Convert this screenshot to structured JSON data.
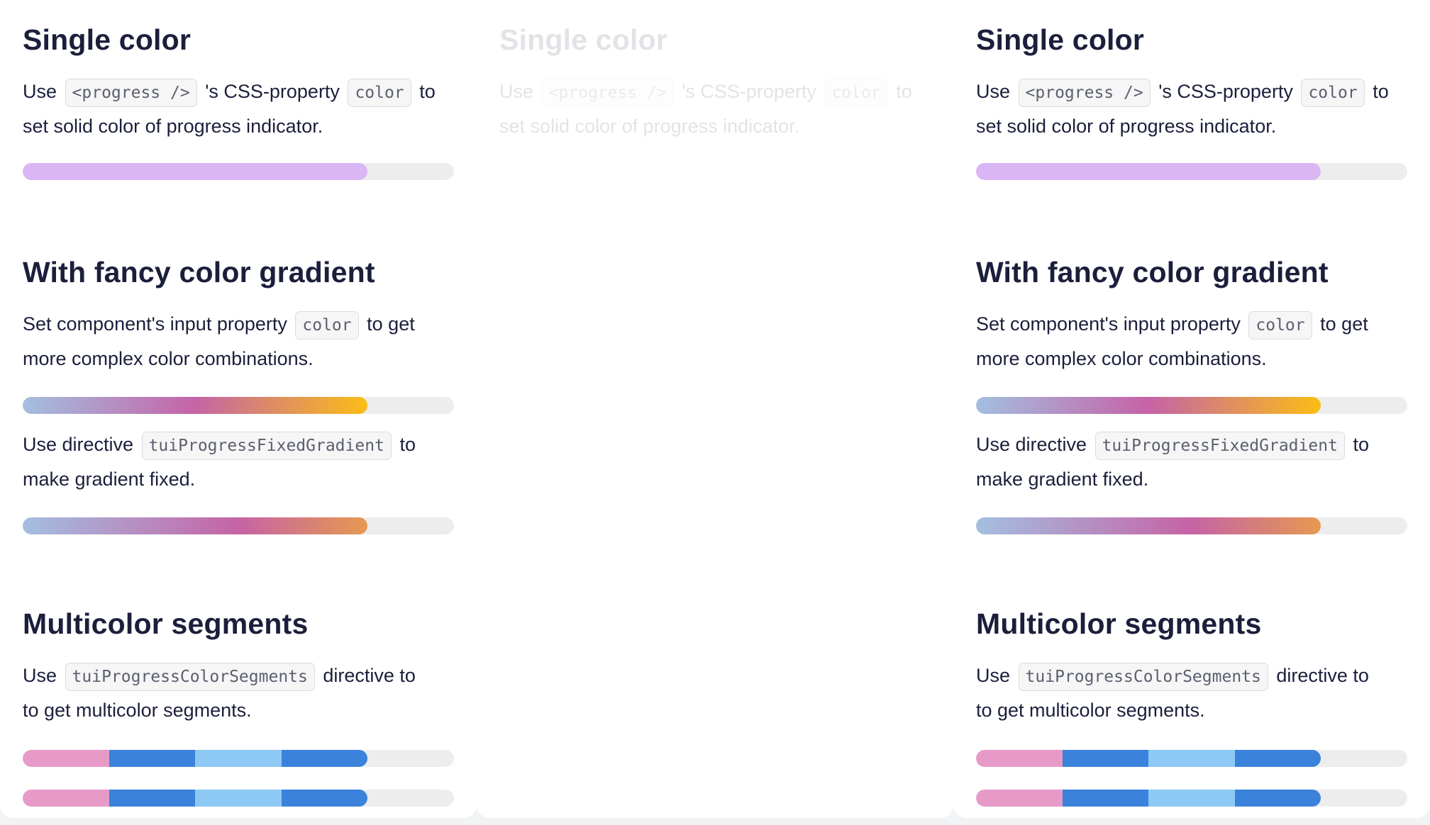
{
  "sections": {
    "single": {
      "title": "Single color",
      "text_use": "Use",
      "code_progress": "<progress />",
      "text_css": "'s CSS-property",
      "code_color": "color",
      "text_to": "to",
      "text_rest": "set solid color of progress indicator."
    },
    "gradient": {
      "title": "With fancy color gradient",
      "text_set": "Set component's input property",
      "code_color": "color",
      "text_toget": "to get",
      "text_rest": "more complex color combinations.",
      "text_directive": "Use directive",
      "code_fixed": "tuiProgressFixedGradient",
      "text_to": "to",
      "text_fixed": "make gradient fixed."
    },
    "segments": {
      "title": "Multicolor segments",
      "text_use": "Use",
      "code_segments": "tuiProgressColorSegments",
      "text_directive": "directive to",
      "text_rest": "to get multicolor segments."
    }
  },
  "progress": {
    "value": 0.8,
    "solid_color": "#dab6f5",
    "gradient_colors": [
      "#a3bfe0",
      "#c663a6",
      "#fbbd16"
    ],
    "segment_colors": [
      "#e79ac8",
      "#3a82db",
      "#8dc9f4",
      "#3a82db"
    ],
    "track_color": "#ededed"
  }
}
